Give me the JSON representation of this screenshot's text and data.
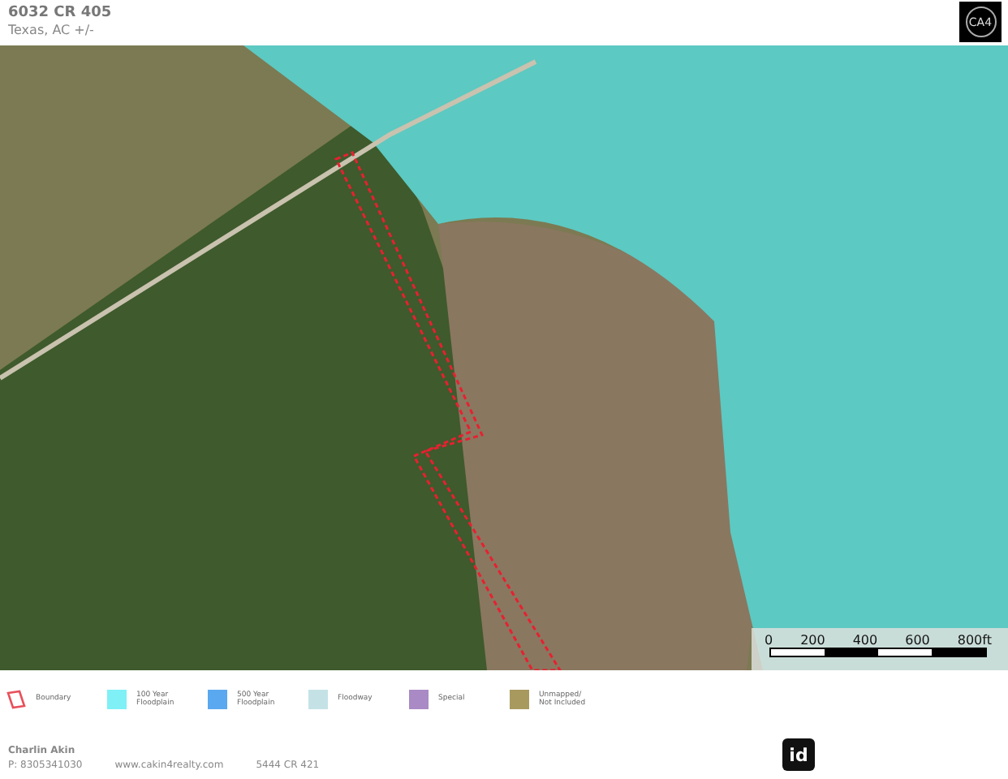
{
  "header": {
    "title": "6032 CR 405",
    "subtitle": "Texas,  AC +/-",
    "logo": "CA4"
  },
  "map": {
    "scale_bar": {
      "labels": [
        "0",
        "200",
        "400",
        "600",
        "800ft"
      ]
    }
  },
  "legend": [
    {
      "kind": "outline",
      "label": "Boundary",
      "color": "#e8505b"
    },
    {
      "kind": "swatch",
      "label": "100 Year Floodplain",
      "color": "#7ef0f6"
    },
    {
      "kind": "swatch",
      "label": "500 Year Floodplain",
      "color": "#5aa8f0"
    },
    {
      "kind": "swatch",
      "label": "Floodway",
      "color": "#c4e2e6"
    },
    {
      "kind": "swatch",
      "label": "Special",
      "color": "#a98ac4"
    },
    {
      "kind": "swatch",
      "label": "Unmapped/ Not Included",
      "color": "#a89a5e"
    }
  ],
  "footer": {
    "agent": "Charlin Akin",
    "phone": "P: 8305341030",
    "website": "www.cakin4realty.com",
    "address": "5444 CR 421",
    "badge": "id"
  }
}
